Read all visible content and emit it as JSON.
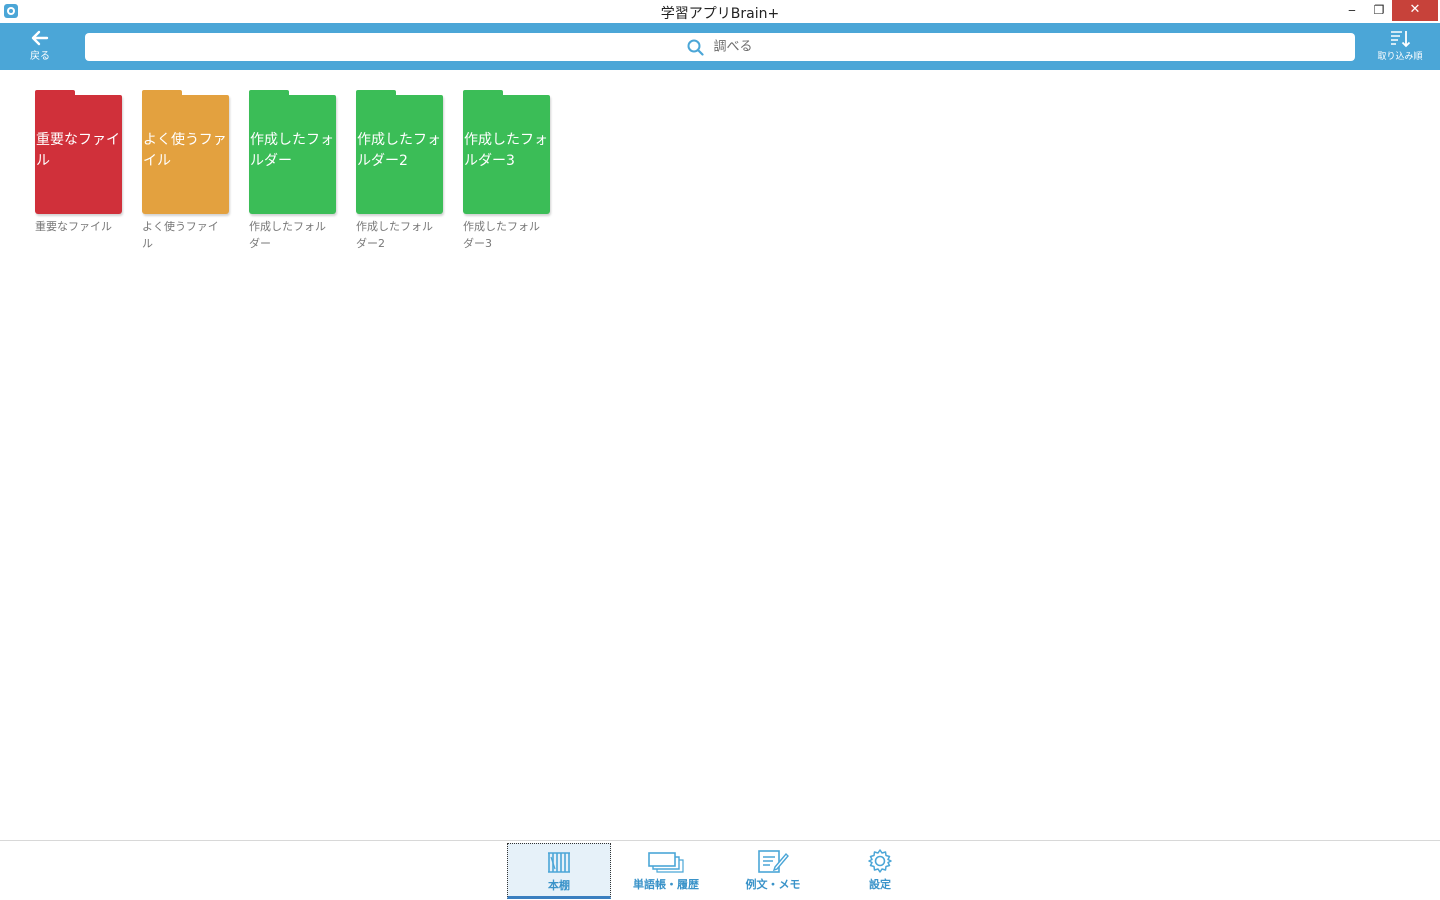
{
  "window": {
    "title": "学習アプリBrain+",
    "controls": {
      "minimize": "‒",
      "restore": "❐",
      "close": "✕"
    }
  },
  "toolbar": {
    "back_label": "戻る",
    "search_placeholder": "調べる",
    "sort_label": "取り込み順",
    "accent_color": "#4ba6d7"
  },
  "folders": [
    {
      "cover": "重要なファイル",
      "caption": "重要なファイル",
      "color": "#d0303a"
    },
    {
      "cover": "よく使うファイル",
      "caption": "よく使うファイル",
      "color": "#e3a13f"
    },
    {
      "cover": "作成したフォルダー",
      "caption": "作成したフォルダー",
      "color": "#3bbd57"
    },
    {
      "cover": "作成したフォルダー2",
      "caption": "作成したフォルダー2",
      "color": "#3bbd57"
    },
    {
      "cover": "作成したフォルダー3",
      "caption": "作成したフォルダー3",
      "color": "#3bbd57"
    }
  ],
  "bottom_nav": {
    "items": [
      {
        "label": "本棚",
        "icon": "bookshelf-icon",
        "active": true
      },
      {
        "label": "単語帳・履歴",
        "icon": "cards-icon",
        "active": false
      },
      {
        "label": "例文・メモ",
        "icon": "memo-icon",
        "active": false
      },
      {
        "label": "設定",
        "icon": "gear-icon",
        "active": false
      }
    ]
  }
}
